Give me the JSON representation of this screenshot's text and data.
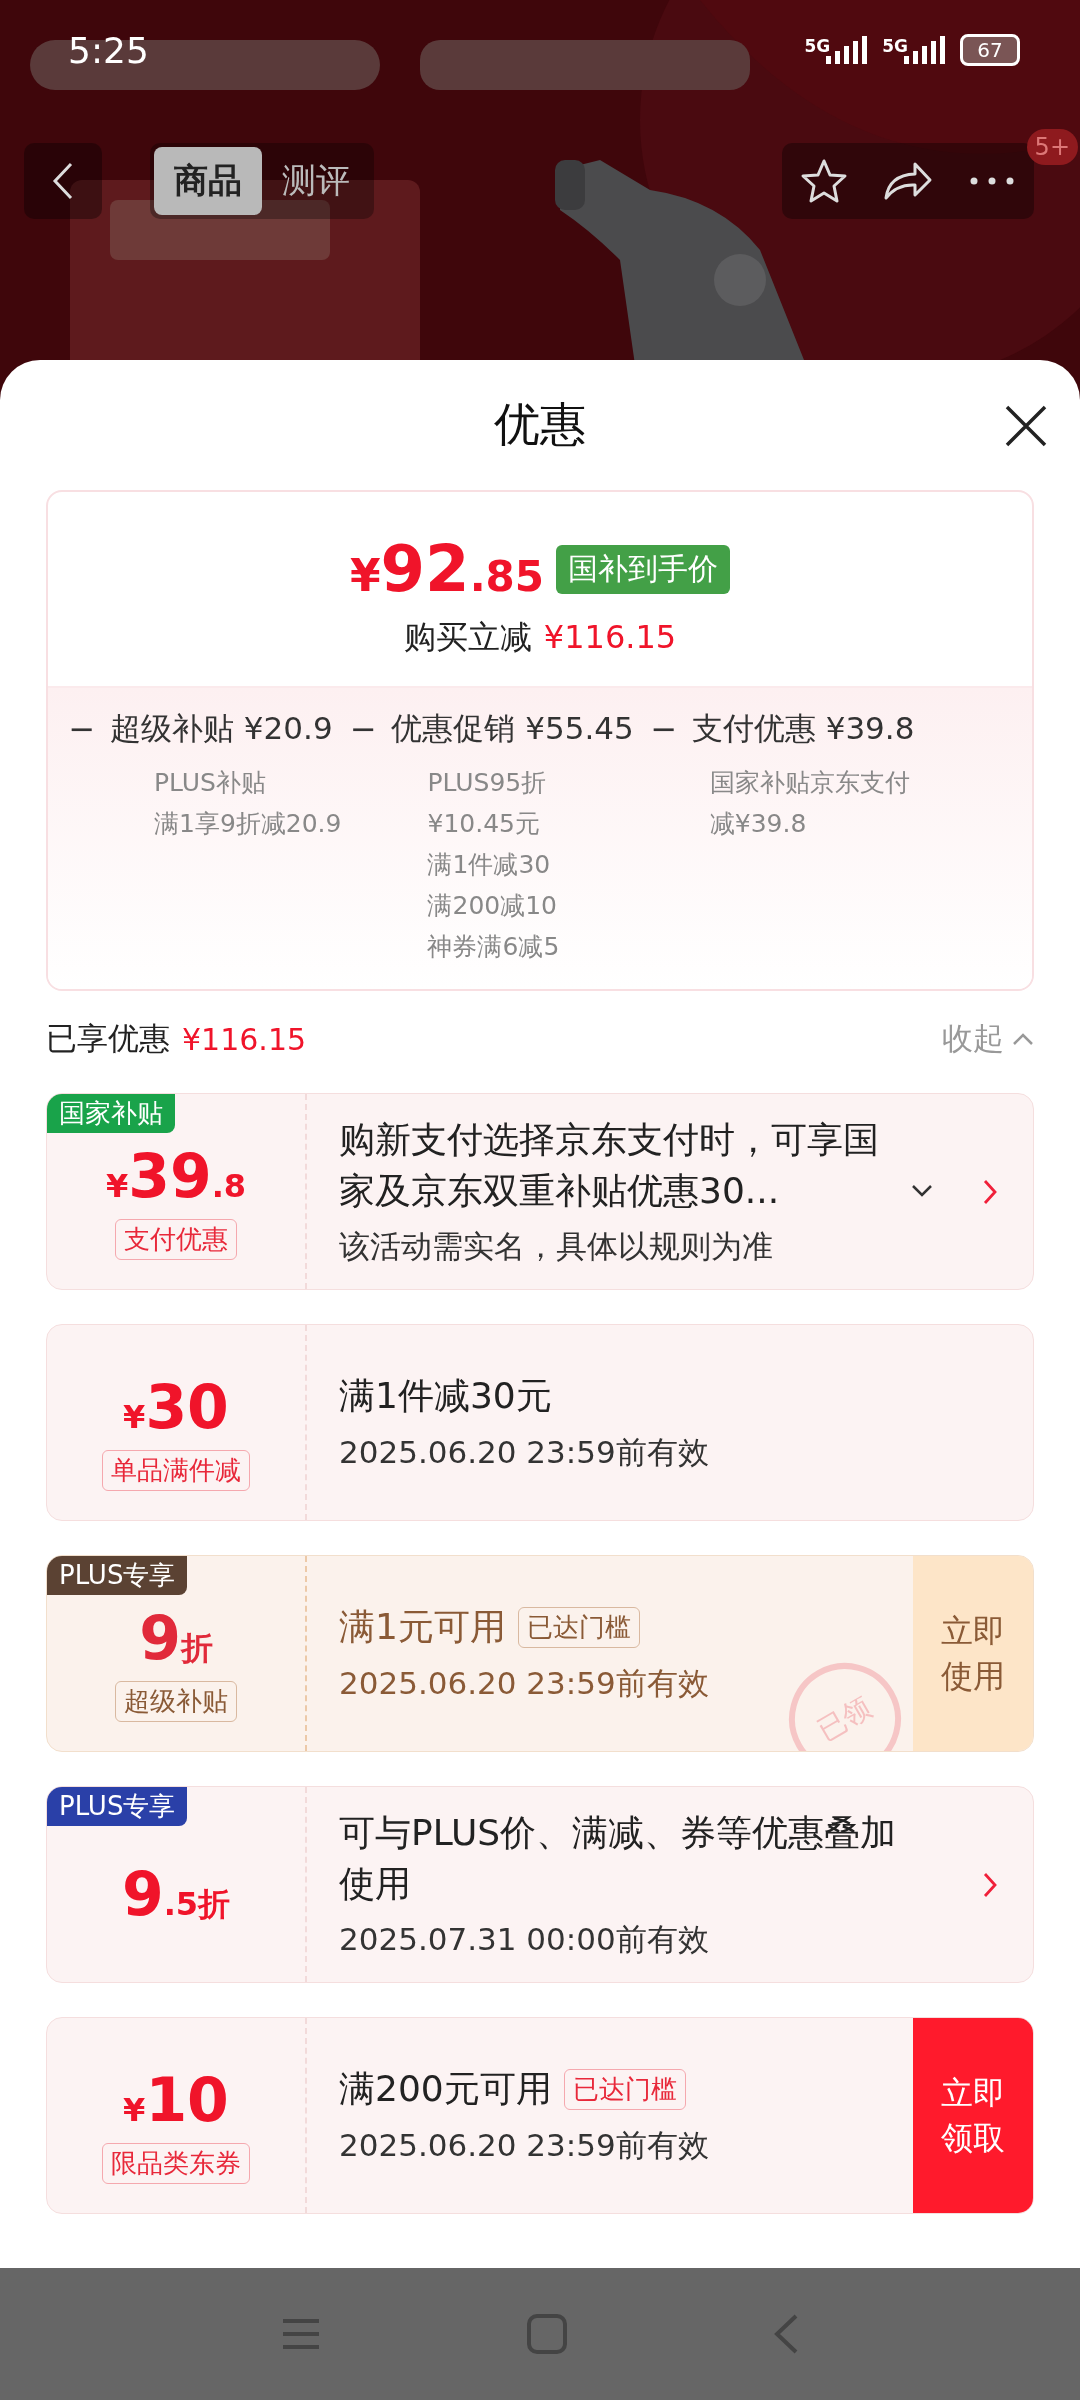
{
  "status_bar": {
    "time": "5:25",
    "networks": [
      "5G",
      "5G"
    ],
    "battery": "67"
  },
  "nav": {
    "tabs": [
      {
        "label": "商品",
        "selected": true
      },
      {
        "label": "测评",
        "selected": false
      }
    ],
    "badge": "5+"
  },
  "sheet": {
    "title": "优惠",
    "price_card": {
      "currency": "¥",
      "price_main": "92",
      "price_fraction": ".85",
      "price_tag": "国补到手价",
      "saving_label": "购买立减",
      "saving_amount": "¥116.15",
      "breakdown": [
        {
          "operator": "−",
          "title": "超级补贴 ¥20.9",
          "details": [
            "PLUS补贴",
            "满1享9折减20.9"
          ]
        },
        {
          "operator": "−",
          "title": "优惠促销 ¥55.45",
          "details": [
            "PLUS95折",
            "¥10.45元",
            "满1件减30",
            "满200减10",
            "神券满6减5"
          ]
        },
        {
          "operator": "−",
          "title": "支付优惠 ¥39.8",
          "details": [
            "国家补贴京东支付",
            "减¥39.8"
          ]
        }
      ]
    },
    "summary": {
      "label": "已享优惠",
      "amount": "¥116.15",
      "toggle": "收起",
      "expanded": true
    },
    "coupons": [
      {
        "kind": "red",
        "tag": {
          "text": "国家补贴",
          "color": "#19a34a"
        },
        "amount": {
          "prefix": "¥",
          "main": "39",
          "suffix": ".8"
        },
        "label": "支付优惠",
        "title": "购新支付选择京东支付时，可享国家及京东双重补贴优惠30...",
        "expandable": true,
        "note": "该活动需实名，具体以规则为准",
        "arrow": true
      },
      {
        "kind": "red",
        "amount": {
          "prefix": "¥",
          "main": "30"
        },
        "label": "单品满件减",
        "title": "满1件减30元",
        "note": "2025.06.20 23:59前有效"
      },
      {
        "kind": "gold",
        "tag": {
          "text": "PLUS专享",
          "color": "#5b4233"
        },
        "amount": {
          "main": "9",
          "suffix": "折"
        },
        "label": "超级补贴",
        "title": "满1元可用",
        "badge": "已达门槛",
        "note": "2025.06.20 23:59前有效",
        "action": "立即使用",
        "stamp": "已领"
      },
      {
        "kind": "red",
        "tag": {
          "text": "PLUS专享",
          "color": "#2a40a8"
        },
        "amount": {
          "main": "9",
          "suffix": ".5折"
        },
        "title": "可与PLUS价、满减、券等优惠叠加使用",
        "note": "2025.07.31 00:00前有效",
        "arrow": true
      },
      {
        "kind": "red",
        "amount": {
          "prefix": "¥",
          "main": "10"
        },
        "label": "限品类东券",
        "title": "满200元可用",
        "badge": "已达门槛",
        "note": "2025.06.20 23:59前有效",
        "action": "立即领取"
      }
    ]
  }
}
